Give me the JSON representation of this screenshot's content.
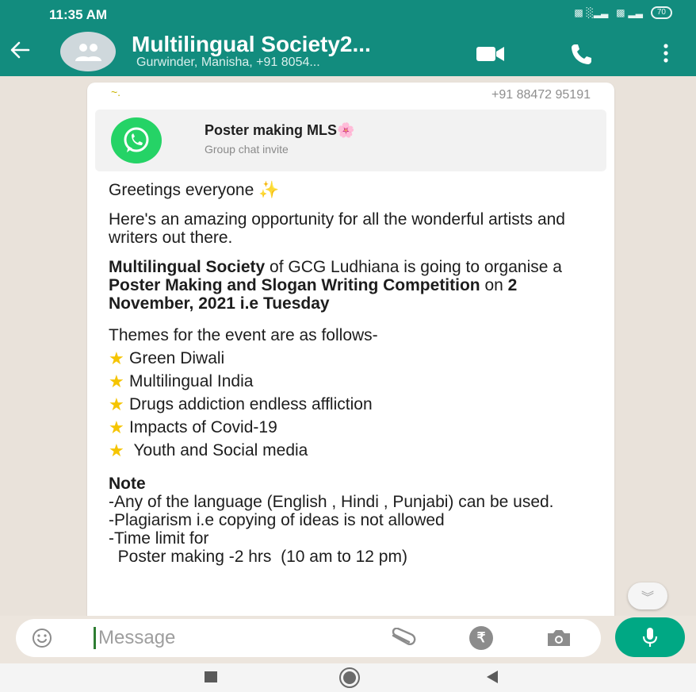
{
  "status_bar": {
    "time": "11:35 AM",
    "signal_1": "▩ ░▂▃",
    "signal_2": "▩ ▂▃",
    "battery": "70"
  },
  "header": {
    "title": "Multilingual Society2...",
    "subtitle": "Gurwinder, Manisha, +91 8054...",
    "back_icon": "arrow-left",
    "video_icon": "video-camera",
    "call_icon": "phone",
    "menu_icon": "vertical-dots"
  },
  "message": {
    "sender_name": "~.",
    "sender_phone": "+91 88472 95191",
    "invite": {
      "title": "Poster making MLS🌸",
      "subtitle": "Group chat invite"
    },
    "greeting": "Greetings everyone ✨",
    "intro": "Here's an amazing opportunity for all the wonderful artists and writers out there.",
    "announcement": {
      "org": "Multilingual Society",
      "text_1": " of GCG Ludhiana is going to organise a ",
      "event": "Poster Making and Slogan Writing Competition",
      "text_2": " on ",
      "date": "2 November, 2021 i.e Tuesday"
    },
    "themes_heading": "Themes for the event are as follows-",
    "themes": [
      "Green Diwali",
      "Multilingual India",
      "Drugs addiction endless affliction",
      "Impacts of Covid-19",
      " Youth and Social media"
    ],
    "note_heading": "Note",
    "notes": [
      "-Any of the language (English , Hindi , Punjabi) can be used.",
      "-Plagiarism i.e copying of ideas is not allowed",
      "-Time limit for",
      "  Poster making -2 hrs  (10 am to 12 pm)"
    ]
  },
  "input": {
    "placeholder": "Message"
  },
  "colors": {
    "header": "#128c7e",
    "accent": "#00a884",
    "chat_bg": "#e9e2da"
  }
}
